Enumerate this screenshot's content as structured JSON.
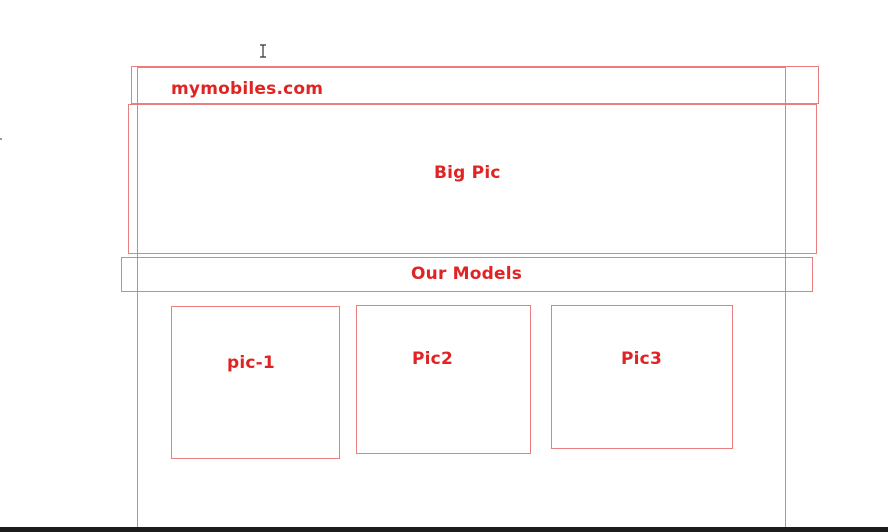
{
  "header": {
    "site_name": "mymobiles.com"
  },
  "hero": {
    "label": "Big Pic"
  },
  "models_section": {
    "title": "Our Models"
  },
  "models": [
    {
      "label": "pic-1"
    },
    {
      "label": "Pic2"
    },
    {
      "label": "Pic3"
    }
  ],
  "colors": {
    "outline": "#e87e7e",
    "text": "#e02424"
  }
}
